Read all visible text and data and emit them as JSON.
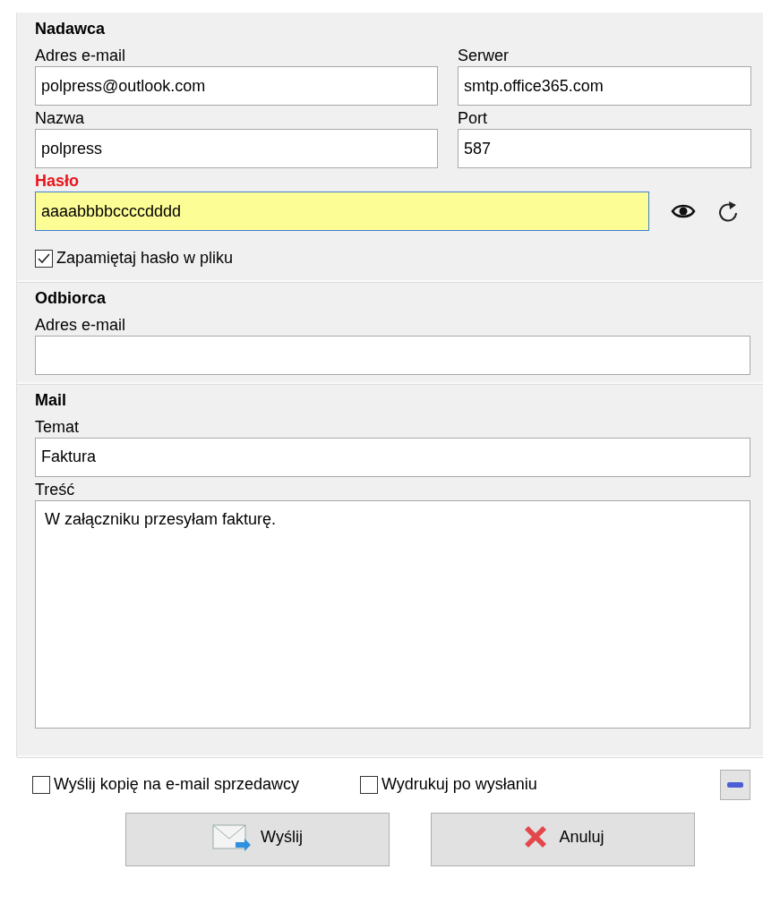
{
  "sender": {
    "title": "Nadawca",
    "email": {
      "label": "Adres e-mail",
      "value": "polpress@outlook.com"
    },
    "server": {
      "label": "Serwer",
      "value": "smtp.office365.com"
    },
    "name": {
      "label": "Nazwa",
      "value": "polpress"
    },
    "port": {
      "label": "Port",
      "value": "587"
    },
    "password": {
      "label": "Hasło",
      "value": "aaaabbbbccccdddd",
      "error": true,
      "focused": true
    },
    "remember": {
      "label": "Zapamiętaj hasło w pliku",
      "checked": true
    }
  },
  "recipient": {
    "title": "Odbiorca",
    "email": {
      "label": "Adres e-mail"
    }
  },
  "mail": {
    "title": "Mail",
    "subject": {
      "label": "Temat",
      "value": "Faktura"
    },
    "body": {
      "label": "Treść",
      "value": "W załączniku przesyłam fakturę."
    }
  },
  "options": [
    {
      "label": "Wyślij kopię na e-mail sprzedawcy",
      "checked": false
    },
    {
      "label": "Wydrukuj po wysłaniu",
      "checked": false
    }
  ],
  "buttons": [
    {
      "label": "Wyślij",
      "kind": "send"
    },
    {
      "label": "Anuluj",
      "kind": "cancel"
    }
  ]
}
